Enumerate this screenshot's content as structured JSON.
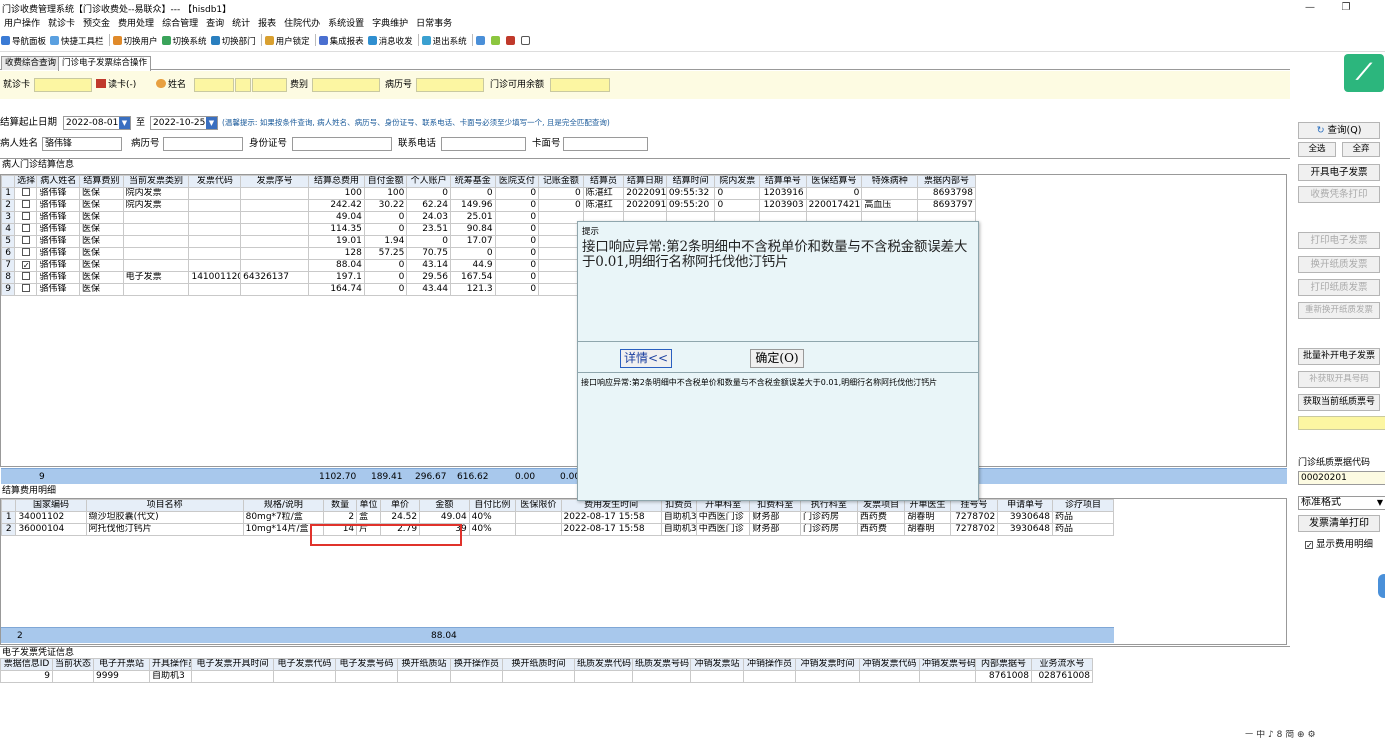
{
  "window": {
    "title": "门诊收费管理系统【门诊收费处--易联众】--- 【hisdb1】",
    "controls": [
      "—",
      "❐",
      "✕"
    ]
  },
  "menu": [
    "用户操作",
    "就诊卡",
    "预交金",
    "费用处理",
    "综合管理",
    "查询",
    "统计",
    "报表",
    "住院代办",
    "系统设置",
    "字典维护",
    "日常事务"
  ],
  "toolbar": {
    "items": [
      {
        "label": "导航面板",
        "icon": "navigation-icon",
        "color": "#3a7bd5"
      },
      {
        "label": "快捷工具栏",
        "icon": "shortcut-icon",
        "color": "#5aa0e0"
      },
      {
        "label": "切换用户",
        "icon": "switch-user-icon",
        "color": "#e08a2a"
      },
      {
        "label": "切换系统",
        "icon": "switch-system-icon",
        "color": "#3aa35a"
      },
      {
        "label": "切换部门",
        "icon": "switch-dept-icon",
        "color": "#2a7fbf"
      },
      {
        "label": "用户锁定",
        "icon": "lock-icon",
        "color": "#d9a030"
      },
      {
        "label": "集成报表",
        "icon": "report-icon",
        "color": "#4a6fd0"
      },
      {
        "label": "消息收发",
        "icon": "message-icon",
        "color": "#2f8fd0"
      },
      {
        "label": "退出系统",
        "icon": "exit-icon",
        "color": "#3aa0d0"
      }
    ],
    "extra_icons": [
      "help-icon",
      "plugin-icon",
      "tools-icon",
      "window-icon"
    ]
  },
  "tabs": [
    {
      "label": "收费综合查询",
      "active": false
    },
    {
      "label": "门诊电子发票综合操作",
      "active": true
    }
  ],
  "card_row": {
    "card_label": "就诊卡",
    "read_card_label": "读卡(-)",
    "name_label": "姓名",
    "fee_type_label": "费别",
    "record_label": "病历号",
    "balance_label": "门诊可用余额"
  },
  "filter": {
    "date_label": "结算起止日期",
    "date_from": "2022-08-01",
    "to_label": "至",
    "date_to": "2022-10-25",
    "hint": "(温馨提示: 如果按条件查询, 病人姓名、病历号、身份证号、联系电话、卡面号必须至少填写一个, 且是完全匹配查询)",
    "patient_name_label": "病人姓名",
    "patient_name": "骆伟锋",
    "record_no_label": "病历号",
    "id_label": "身份证号",
    "phone_label": "联系电话",
    "card_face_label": "卡面号"
  },
  "settlement": {
    "section_title": "病人门诊结算信息",
    "headers": [
      "选择",
      "病人姓名",
      "结算费别",
      "当前发票类别",
      "发票代码",
      "发票序号",
      "结算总费用",
      "自付金额",
      "个人账户",
      "统筹基金",
      "医院支付",
      "记账金额",
      "结算员",
      "结算日期",
      "结算时间",
      "院内发票",
      "结算单号",
      "医保结算号",
      "特殊病种",
      "票据内部号"
    ],
    "rows": [
      {
        "no": "1",
        "checked": false,
        "cells": [
          "骆伟锋",
          "医保",
          "院内发票",
          "",
          "",
          "100",
          "100",
          "0",
          "0",
          "0",
          "0",
          "陈湛红",
          "20220917",
          "09:55:32",
          "0",
          "1203916",
          "0",
          "",
          "8693798"
        ]
      },
      {
        "no": "2",
        "checked": false,
        "cells": [
          "骆伟锋",
          "医保",
          "院内发票",
          "",
          "",
          "242.42",
          "30.22",
          "62.24",
          "149.96",
          "0",
          "0",
          "陈湛红",
          "20220917",
          "09:55:20",
          "0",
          "1203903",
          "220017421",
          "高血压",
          "8693797"
        ]
      },
      {
        "no": "3",
        "checked": false,
        "cells": [
          "骆伟锋",
          "医保",
          "",
          "",
          "",
          "49.04",
          "0",
          "24.03",
          "25.01",
          "0",
          "",
          "",
          "",
          "",
          "",
          "",
          "",
          "",
          ""
        ]
      },
      {
        "no": "4",
        "checked": false,
        "cells": [
          "骆伟锋",
          "医保",
          "",
          "",
          "",
          "114.35",
          "0",
          "23.51",
          "90.84",
          "0",
          "",
          "",
          "",
          "",
          "",
          "",
          "",
          "",
          ""
        ]
      },
      {
        "no": "5",
        "checked": false,
        "cells": [
          "骆伟锋",
          "医保",
          "",
          "",
          "",
          "19.01",
          "1.94",
          "0",
          "17.07",
          "0",
          "",
          "",
          "",
          "",
          "",
          "",
          "",
          "",
          ""
        ]
      },
      {
        "no": "6",
        "checked": false,
        "cells": [
          "骆伟锋",
          "医保",
          "",
          "",
          "",
          "128",
          "57.25",
          "70.75",
          "0",
          "0",
          "",
          "",
          "",
          "",
          "",
          "",
          "",
          "",
          ""
        ]
      },
      {
        "no": "7",
        "checked": true,
        "cells": [
          "骆伟锋",
          "医保",
          "",
          "",
          "",
          "88.04",
          "0",
          "43.14",
          "44.9",
          "0",
          "",
          "",
          "",
          "",
          "",
          "",
          "",
          "",
          ""
        ]
      },
      {
        "no": "8",
        "checked": false,
        "cells": [
          "骆伟锋",
          "医保",
          "电子发票",
          "141001120",
          "64326137",
          "197.1",
          "0",
          "29.56",
          "167.54",
          "0",
          "",
          "",
          "",
          "",
          "",
          "",
          "",
          "",
          ""
        ]
      },
      {
        "no": "9",
        "checked": false,
        "cells": [
          "骆伟锋",
          "医保",
          "",
          "",
          "",
          "164.74",
          "0",
          "43.44",
          "121.3",
          "0",
          "",
          "",
          "",
          "",
          "",
          "",
          "",
          "",
          ""
        ]
      }
    ],
    "summary": {
      "count": "9",
      "total": "1102.70",
      "self_pay": "189.41",
      "personal": "296.67",
      "pooled": "616.62",
      "hospital": "0.00",
      "account": "0.00"
    }
  },
  "details": {
    "section_title": "结算费用明细",
    "headers": [
      "国家编码",
      "项目名称",
      "规格/说明",
      "数量",
      "单位",
      "单价",
      "金额",
      "自付比例",
      "医保限价",
      "费用发生时间",
      "扣费员",
      "开单科室",
      "扣费科室",
      "执行科室",
      "发票项目",
      "开单医生",
      "挂号号",
      "申请单号",
      "诊疗项目"
    ],
    "rows": [
      {
        "no": "1",
        "cells": [
          "34001102",
          "缬沙坦胶囊(代文)",
          "80mg*7粒/盒",
          "2",
          "盒",
          "24.52",
          "49.04",
          "40%",
          "",
          "2022-08-17 15:58",
          "自助机3",
          "中西医门诊",
          "财务部",
          "门诊药房",
          "西药费",
          "胡春明",
          "7278702",
          "3930648",
          "药品"
        ]
      },
      {
        "no": "2",
        "cells": [
          "36000104",
          "阿托伐他汀钙片",
          "10mg*14片/盒",
          "14",
          "片",
          "2.79",
          "39",
          "40%",
          "",
          "2022-08-17 15:58",
          "自助机3",
          "中西医门诊",
          "财务部",
          "门诊药房",
          "西药费",
          "胡春明",
          "7278702",
          "3930648",
          "药品"
        ]
      }
    ],
    "summary": {
      "count": "2",
      "amount": "88.04"
    }
  },
  "voucher": {
    "section_title": "电子发票凭证信息",
    "headers": [
      "票据信息ID",
      "当前状态",
      "电子开票站",
      "开具操作员",
      "电子发票开具时间",
      "电子发票代码",
      "电子发票号码",
      "换开纸质站",
      "换开操作员",
      "换开纸质时间",
      "纸质发票代码",
      "纸质发票号码",
      "冲销发票站",
      "冲销操作员",
      "冲销发票时间",
      "冲销发票代码",
      "冲销发票号码",
      "内部票据号",
      "业务流水号"
    ],
    "rows": [
      {
        "cells": [
          "9",
          "",
          "9999",
          "自助机3",
          "",
          "",
          "",
          "",
          "",
          "",
          "",
          "",
          "",
          "",
          "",
          "",
          "",
          "8761008",
          "028761008"
        ]
      }
    ]
  },
  "right_panel": {
    "query": "查询(Q)",
    "select_all": "全选",
    "deselect_all": "全弃",
    "buttons": [
      {
        "label": "开具电子发票",
        "enabled": true
      },
      {
        "label": "收费凭条打印",
        "enabled": false
      },
      {
        "label": "打印电子发票",
        "enabled": false
      },
      {
        "label": "换开纸质发票",
        "enabled": false
      },
      {
        "label": "打印纸质发票",
        "enabled": false
      },
      {
        "label": "重新换开纸质发票",
        "enabled": false
      },
      {
        "label": "批量补开电子发票",
        "enabled": true
      },
      {
        "label": "补获取开具号码",
        "enabled": false
      },
      {
        "label": "获取当前纸质票号",
        "enabled": true
      }
    ],
    "paper_code_label": "门诊纸质票据代码",
    "paper_code": "00020201",
    "format_select": "标准格式",
    "print_list": "发票清单打印",
    "show_details": "显示费用明细",
    "show_details_checked": true
  },
  "dialog": {
    "title": "提示",
    "message": "接口响应异常:第2条明细中不含税单价和数量与不含税金额误差大于0.01,明细行名称阿托伐他汀钙片",
    "details_button": "详情<<",
    "ok_button": "确定(O)",
    "details_text": "接口响应异常:第2条明细中不含税单价和数量与不含税金额误差大于0.01,明细行名称阿托伐他汀钙片"
  },
  "tray": "ㅡ 中 ♪ 8 简 ⊕ ⚙",
  "accent": {
    "highlight": "#e0322b",
    "summary_bar": "#a8c8ec",
    "input_yellow": "#fcf6a2",
    "logo_green": "#2cb67d"
  }
}
